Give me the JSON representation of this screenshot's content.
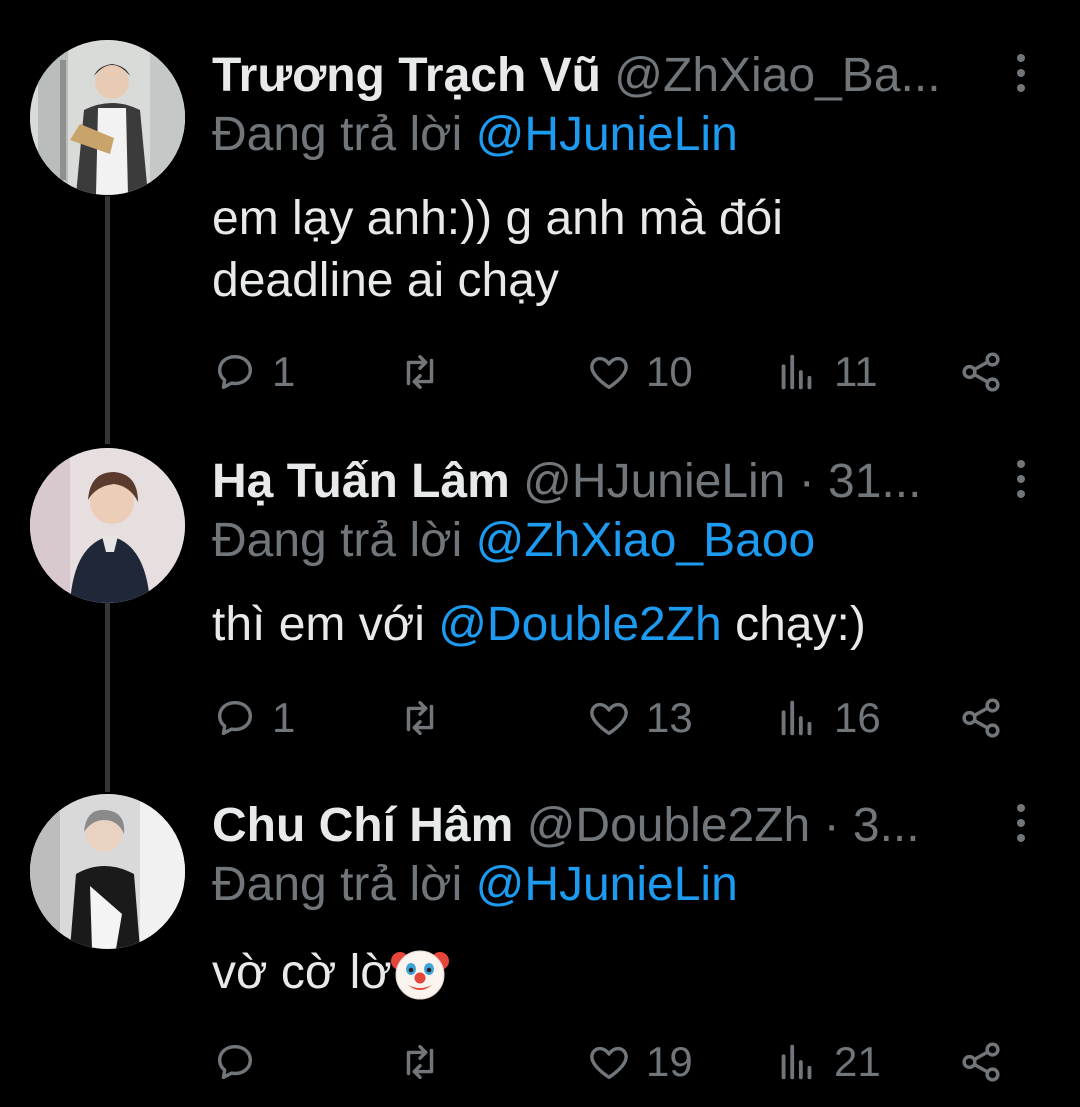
{
  "tweets": [
    {
      "name": "Trương Trạch Vũ",
      "handle": "@ZhXiao_Ba...",
      "reply_prefix": "Đang trả lời",
      "reply_to": "@HJunieLin",
      "text_line1": "em lạy anh:)) g anh mà đói",
      "text_line2": "deadline ai chạy",
      "replies": "1",
      "retweets": "",
      "likes": "10",
      "views": "11"
    },
    {
      "name": "Hạ Tuấn Lâm",
      "handle": "@HJunieLin · 31...",
      "reply_prefix": "Đang trả lời",
      "reply_to": "@ZhXiao_Baoo",
      "text_before": "thì em với ",
      "text_mention": "@Double2Zh",
      "text_after": " chạy:)",
      "replies": "1",
      "retweets": "",
      "likes": "13",
      "views": "16"
    },
    {
      "name": "Chu Chí Hâm",
      "handle": "@Double2Zh · 3...",
      "reply_prefix": "Đang trả lời",
      "reply_to": "@HJunieLin",
      "text": "vờ cờ lờ",
      "emoji": "clown-face",
      "replies": "",
      "retweets": "",
      "likes": "19",
      "views": "21"
    }
  ],
  "icons": {
    "reply": "reply-icon",
    "retweet": "retweet-icon",
    "like": "heart-icon",
    "views": "views-icon",
    "share": "share-icon",
    "more": "more-icon"
  },
  "colors": {
    "background": "#000000",
    "text": "#e7e9ea",
    "muted": "#71767b",
    "link": "#1d9bf0"
  }
}
